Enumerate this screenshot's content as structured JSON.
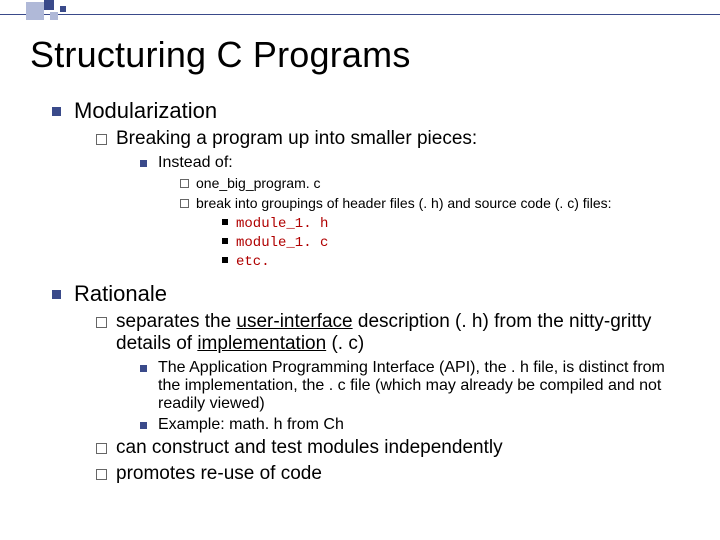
{
  "title": "Structuring C Programs",
  "sec1": {
    "heading": "Modularization",
    "sub1": "Breaking a program up into smaller pieces:",
    "sub1a": "Instead of:",
    "sub1a_i": "one_big_program. c",
    "sub1a_ii": "break into groupings of header files (. h) and source code (. c) files:",
    "file1": "module_1. h",
    "file2": "module_1. c",
    "file3": "etc."
  },
  "sec2": {
    "heading": "Rationale",
    "p1_a": "separates the ",
    "p1_u1": "user-interface",
    "p1_b": " description (. h) from the nitty-gritty details of ",
    "p1_u2": "implementation",
    "p1_c": " (. c)",
    "p1_sub1": "The Application Programming Interface (API), the . h file, is distinct from the implementation, the . c file (which may already be compiled and not readily viewed)",
    "p1_sub2": "Example: math. h from Ch",
    "p2": "can construct and test modules independently",
    "p3": "promotes re-use of code"
  }
}
